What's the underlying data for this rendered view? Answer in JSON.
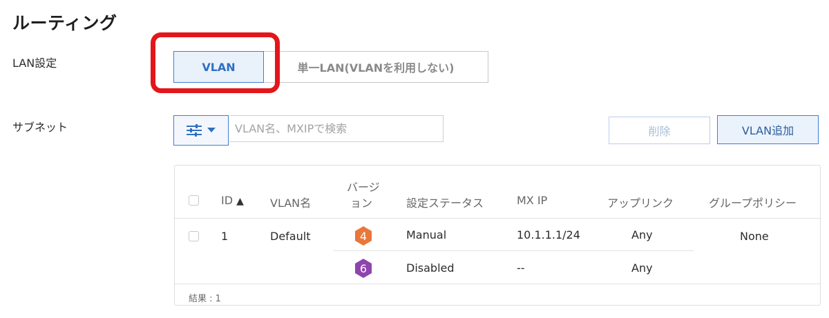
{
  "page": {
    "title": "ルーティング"
  },
  "lan_settings": {
    "label": "LAN設定",
    "options": [
      "VLAN",
      "単一LAN(VLANを利用しない)"
    ],
    "selected": "VLAN"
  },
  "subnet": {
    "label": "サブネット",
    "search_placeholder": "VLAN名、MXIPで検索",
    "delete_label": "削除",
    "add_label": "VLAN追加"
  },
  "table": {
    "headers": {
      "id": "ID",
      "sort_indicator": "▲",
      "vlan_name": "VLAN名",
      "version_line1": "バージ",
      "version_line2": "ョン",
      "config_status": "設定ステータス",
      "mx_ip": "MX IP",
      "uplink": "アップリンク",
      "group_policy": "グループポリシー"
    },
    "rows": [
      {
        "id": "1",
        "vlan_name": "Default",
        "group_policy": "None",
        "sub": [
          {
            "version": "4",
            "version_color": "#e8773a",
            "status": "Manual",
            "mx_ip": "10.1.1.1/24",
            "uplink": "Any"
          },
          {
            "version": "6",
            "version_color": "#8e44ad",
            "status": "Disabled",
            "mx_ip": "--",
            "uplink": "Any"
          }
        ]
      }
    ],
    "footer": "結果 : 1"
  }
}
